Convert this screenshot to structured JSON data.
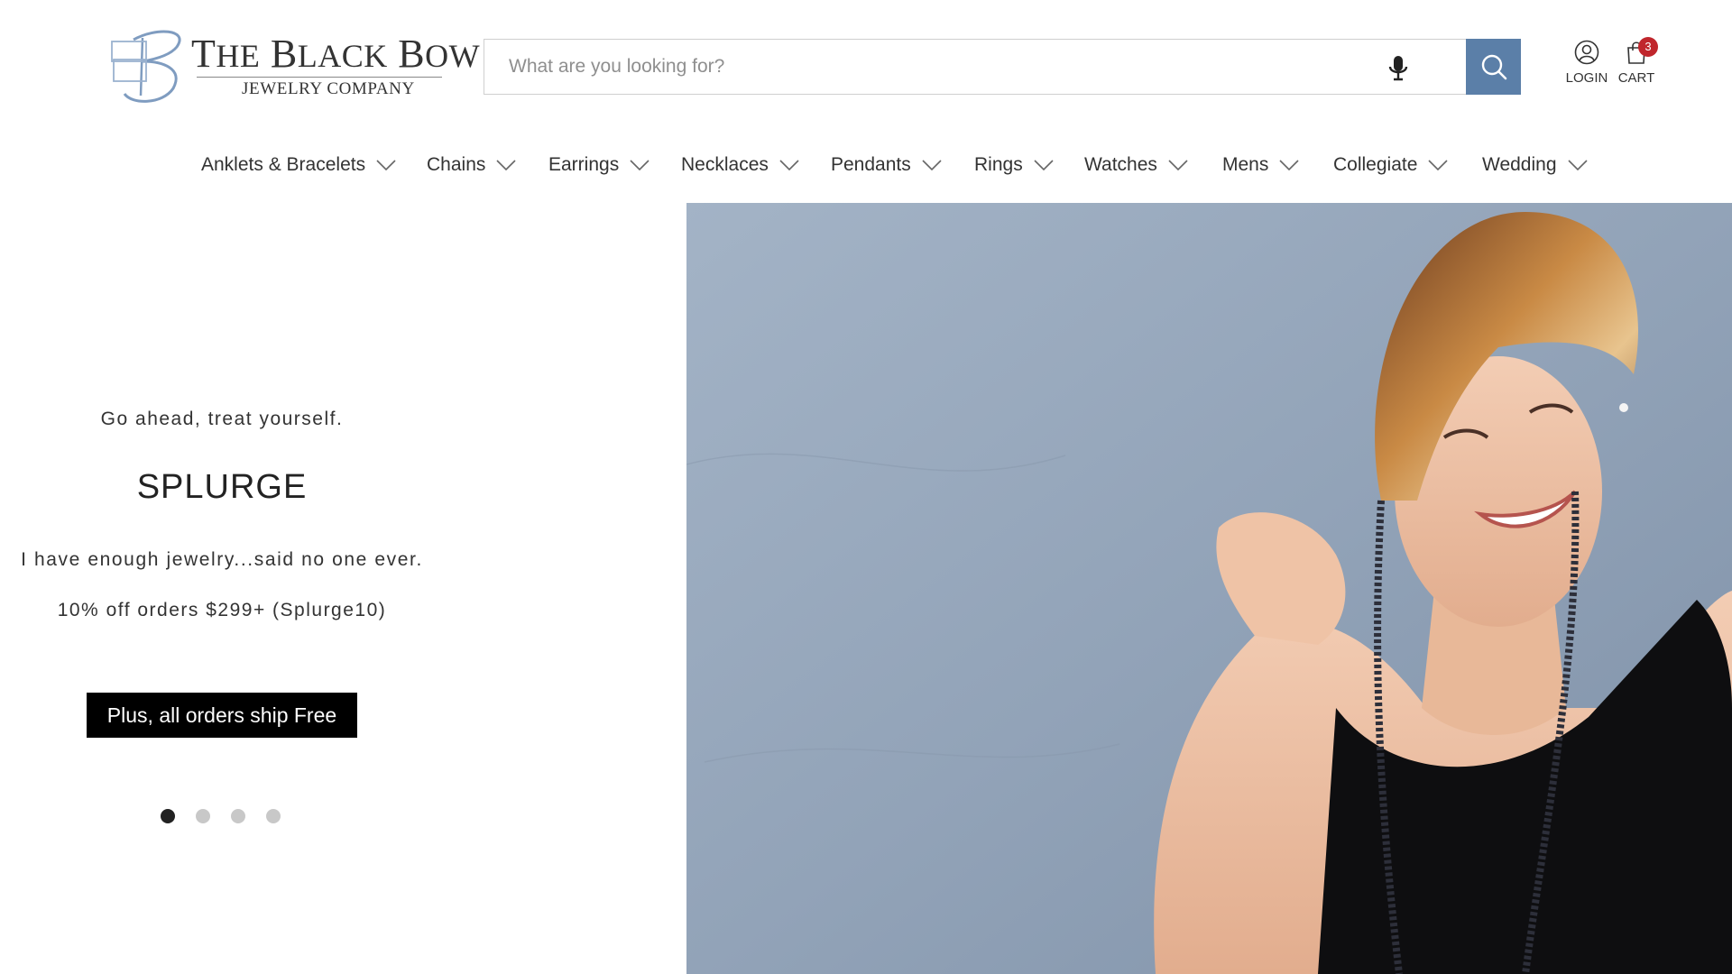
{
  "header": {
    "logo": {
      "title_initials": [
        "T",
        "B",
        "B"
      ],
      "title_rest": [
        "HE",
        "LACK",
        "OW"
      ],
      "title_full": "The Black Bow",
      "subtitle": "JEWELRY COMPANY"
    },
    "search": {
      "placeholder": "What are you looking for?",
      "value": "",
      "accent_color": "#5b7fa8"
    },
    "account": {
      "login_label": "LOGIN",
      "cart_label": "CART",
      "cart_count": "3",
      "badge_color": "#c0262c"
    }
  },
  "nav": {
    "items": [
      {
        "label": "Anklets & Bracelets"
      },
      {
        "label": "Chains"
      },
      {
        "label": "Earrings"
      },
      {
        "label": "Necklaces"
      },
      {
        "label": "Pendants"
      },
      {
        "label": "Rings"
      },
      {
        "label": "Watches"
      },
      {
        "label": "Mens"
      },
      {
        "label": "Collegiate"
      },
      {
        "label": "Wedding"
      }
    ]
  },
  "hero": {
    "eyebrow": "Go ahead, treat yourself.",
    "headline": "SPLURGE",
    "body": "I have enough jewelry...said no one ever.",
    "offer": "10% off orders $299+ (Splurge10)",
    "cta_label": "Plus, all orders ship Free",
    "slides_total": 4,
    "active_slide": 1
  }
}
